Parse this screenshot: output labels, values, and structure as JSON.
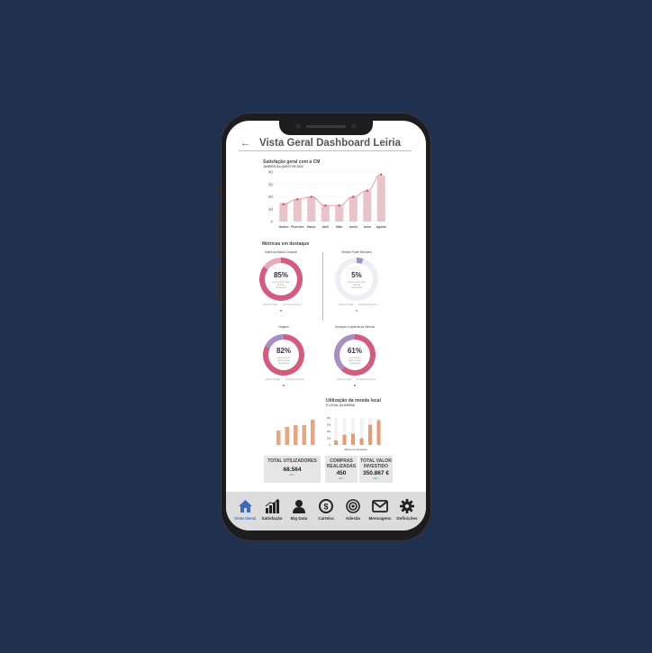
{
  "header": {
    "back_icon": "←",
    "title": "Vista Geral Dashboard Leiria"
  },
  "satisfaction": {
    "title": "Satisfação geral com a CM",
    "subtitle": "JANEIRO DA QUEST DE 2022",
    "chart_data": {
      "type": "bar",
      "categories": [
        "Janeiro",
        "Fevereiro",
        "Março",
        "Abril",
        "Maio",
        "Junho",
        "Julho",
        "Agosto"
      ],
      "series": [
        {
          "type": "bar",
          "values": [
            15,
            18,
            20,
            13,
            13,
            20,
            25,
            37
          ]
        },
        {
          "type": "line",
          "values": [
            14,
            18,
            20,
            13,
            13,
            20,
            25,
            38
          ]
        }
      ],
      "yticks": [
        "0",
        "10",
        "20",
        "30",
        "40"
      ],
      "ylim": [
        0,
        40
      ],
      "bar_color": "#e8c4c8",
      "line_color": "#e78c98"
    }
  },
  "metrics": {
    "title": "Métricas em destaque",
    "donuts": [
      {
        "title": "Índice da Marca Corporal",
        "value": 85,
        "label": "85%",
        "desc": "Lorem ipsum dolor sit amet consectetur",
        "legend": [
          "Últimos 30 dias",
          "Períodos anteriores"
        ],
        "color_main": "#d6597e",
        "color_secondary": "#e7a9bb"
      },
      {
        "title": "Eleição Poder Bancário",
        "value": 5,
        "label": "5%",
        "desc": "Lorem ipsum dolor sit amet consectetur",
        "legend": [
          "Últimos 30 dias",
          "Períodos anteriores"
        ],
        "color_main": "#a98ec4",
        "color_secondary": "#eeeef4"
      },
      {
        "title": "Viagens",
        "value": 82,
        "label": "82%",
        "desc": "Lorem ipsum dolor sit amet consectetur",
        "legend": [
          "Últimos 30 dias",
          "Períodos anteriores"
        ],
        "color_main": "#d6597e",
        "color_secondary": "#a98ec4"
      },
      {
        "title": "Doenças e epidémicos infectos",
        "value": 61,
        "label": "61%",
        "desc": "Lorem ipsum dolor sit amet consectetur",
        "legend": [
          "Últimos 30 dias",
          "Períodos anteriores"
        ],
        "color_main": "#d6597e",
        "color_secondary": "#a98ec4"
      }
    ]
  },
  "currency": {
    "title": "Utilização da moeda local",
    "subtitle": "E LOCAL DA MOEDA",
    "chart_left": {
      "type": "bar",
      "values": [
        16,
        20,
        22,
        22,
        28
      ],
      "color": "#e79a74"
    },
    "chart_right": {
      "type": "bar",
      "values": [
        4,
        9,
        10,
        6,
        18,
        22
      ],
      "yticks": [
        "40k",
        "30k",
        "20k",
        "10k",
        "0"
      ],
      "xlabel": "Valores de transações",
      "color": "#e79a74"
    }
  },
  "kpis": [
    {
      "label": "TOTAL UTILIZADORES",
      "value": "68.564",
      "delta": "+8% ↑"
    },
    {
      "label": "COMPRAS REALIZADAS",
      "value": "450",
      "delta": "+8% ↑"
    },
    {
      "label": "TOTAL VALOR INVESTIDO",
      "value": "350.867 €",
      "delta": "+8% ↑"
    }
  ],
  "nav": {
    "active_color": "#3b6bbf",
    "items": [
      {
        "label": "Vista Geral",
        "icon": "home-icon"
      },
      {
        "label": "Satisfação",
        "icon": "bar-chart-icon"
      },
      {
        "label": "Big Data",
        "icon": "user-icon"
      },
      {
        "label": "Carteira",
        "icon": "dollar-icon"
      },
      {
        "label": "Adesão",
        "icon": "target-icon"
      },
      {
        "label": "Mensagens",
        "icon": "mail-icon"
      },
      {
        "label": "Definições",
        "icon": "gear-icon"
      }
    ]
  }
}
